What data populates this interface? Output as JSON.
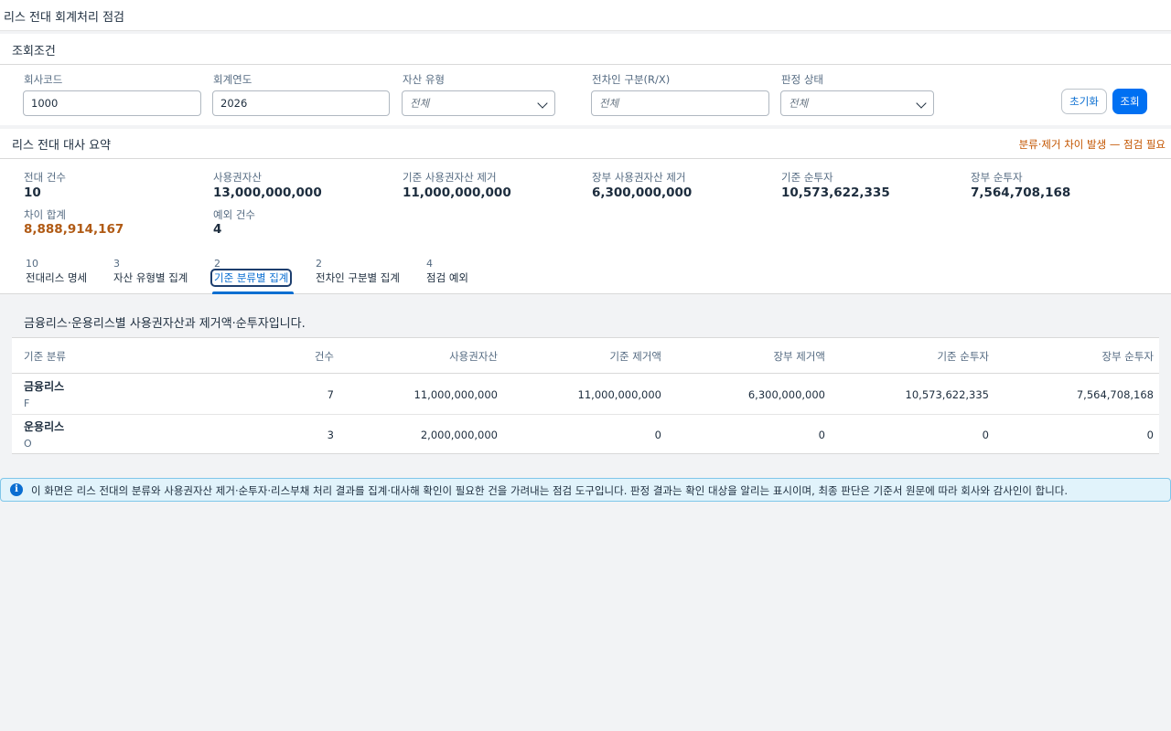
{
  "app": {
    "title": "리스 전대 회계처리 점검"
  },
  "filters": {
    "title": "조회조건",
    "company_code": {
      "label": "회사코드",
      "value": "1000"
    },
    "fiscal_year": {
      "label": "회계연도",
      "value": "2026"
    },
    "asset_type": {
      "label": "자산 유형",
      "value": "전체"
    },
    "sublessee_type": {
      "label": "전차인 구분(R/X)",
      "placeholder": "전체"
    },
    "judgement_status": {
      "label": "판정 상태",
      "value": "전체"
    },
    "reset_label": "초기화",
    "search_label": "조회"
  },
  "summary": {
    "title": "리스 전대 대사 요약",
    "warning": "분류·제거 차이 발생 — 점검 필요",
    "kpis": [
      {
        "label": "전대 건수",
        "value": "10"
      },
      {
        "label": "사용권자산",
        "value": "13,000,000,000"
      },
      {
        "label": "기준 사용권자산 제거",
        "value": "11,000,000,000"
      },
      {
        "label": "장부 사용권자산 제거",
        "value": "6,300,000,000"
      },
      {
        "label": "기준 순투자",
        "value": "10,573,622,335"
      },
      {
        "label": "장부 순투자",
        "value": "7,564,708,168"
      },
      {
        "label": "차이 합계",
        "value": "8,888,914,167"
      },
      {
        "label": "예외 건수",
        "value": "4"
      }
    ],
    "warn_color": "#b05a14"
  },
  "tabs": [
    {
      "count": "10",
      "label": "전대리스 명세"
    },
    {
      "count": "3",
      "label": "자산 유형별 집계"
    },
    {
      "count": "2",
      "label": "기준 분류별 집계"
    },
    {
      "count": "2",
      "label": "전차인 구분별 집계"
    },
    {
      "count": "4",
      "label": "점검 예외"
    }
  ],
  "active_tab": "기준 분류별 집계",
  "content": {
    "description": "금융리스·운용리스별 사용권자산과 제거액·순투자입니다.",
    "columns": [
      "기준 분류",
      "건수",
      "사용권자산",
      "기준 제거액",
      "장부 제거액",
      "기준 순투자",
      "장부 순투자"
    ],
    "rows": [
      {
        "name": "금융리스",
        "code": "F",
        "count": "7",
        "rou_asset": "11,000,000,000",
        "std_removal": "11,000,000,000",
        "book_removal": "6,300,000,000",
        "std_net_investment": "10,573,622,335",
        "book_net_investment": "7,564,708,168"
      },
      {
        "name": "운용리스",
        "code": "O",
        "count": "3",
        "rou_asset": "2,000,000,000",
        "std_removal": "0",
        "book_removal": "0",
        "std_net_investment": "0",
        "book_net_investment": "0"
      }
    ]
  },
  "info": {
    "icon": "info-icon",
    "text": "이 화면은 리스 전대의 분류와 사용권자산 제거·순투자·리스부채 처리 결과를 집계·대사해 확인이 필요한 건을 가려내는 점검 도구입니다. 판정 결과는 확인 대상을 알리는 표시이며, 최종 판단은 기준서 원문에 따라 회사와 감사인이 합니다."
  },
  "colors": {
    "accent": "#0070f2",
    "warning": "#c35500",
    "info_bg": "#e1f3fb"
  }
}
